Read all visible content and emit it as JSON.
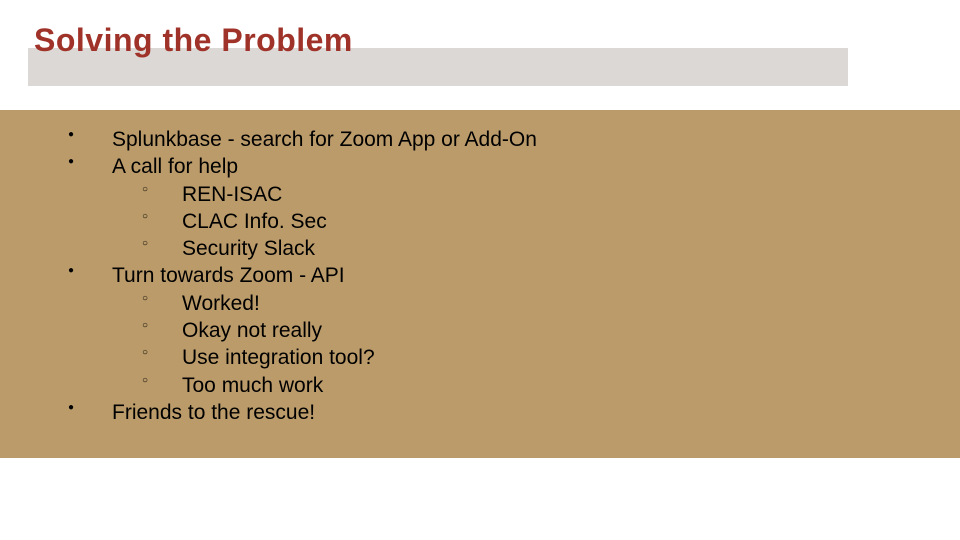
{
  "title": "Solving the Problem",
  "bullets": [
    {
      "text": "Splunkbase - search for Zoom App or Add-On"
    },
    {
      "text": "A call for help",
      "sub": [
        "REN-ISAC",
        "CLAC Info. Sec",
        "Security Slack"
      ]
    },
    {
      "text": "Turn towards Zoom - API",
      "sub": [
        "Worked!",
        "Okay not really",
        "Use integration tool?",
        "Too much work"
      ]
    },
    {
      "text": "Friends to the rescue!"
    }
  ],
  "colors": {
    "title": "#a03329",
    "title_band": "#dcd8d5",
    "content_band": "#bb9b6a",
    "text": "#000000"
  }
}
